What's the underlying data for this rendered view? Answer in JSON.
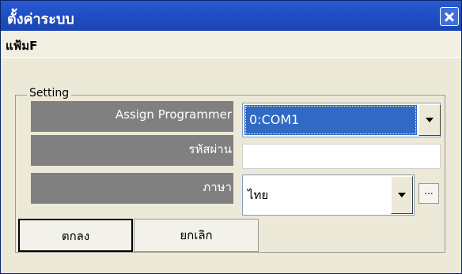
{
  "window": {
    "title": "ตั้งค่าระบบ",
    "close_label": "✕"
  },
  "menu": {
    "items": [
      {
        "label": "แฟ้มF"
      }
    ]
  },
  "settings": {
    "group_label": "Setting",
    "programmer": {
      "label": "Assign Programmer",
      "value": "0:COM1"
    },
    "password": {
      "label": "รหัสผ่าน",
      "value": ""
    },
    "language": {
      "label": "ภาษา",
      "value": "ไทย",
      "extra_button": "..."
    }
  },
  "buttons": {
    "ok": "ตกลง",
    "cancel": "ยกเลิก"
  },
  "colors": {
    "titlebar": "#1f4fc4",
    "selection": "#316ac5",
    "label_background": "#808080",
    "window_face": "#ece9d8"
  }
}
